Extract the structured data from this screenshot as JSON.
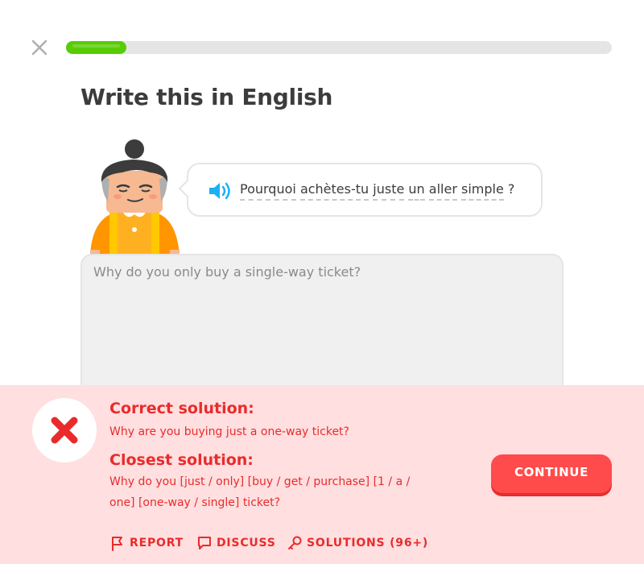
{
  "header": {
    "progress_fraction": 0.11
  },
  "challenge": {
    "title": "Write this in English",
    "prompt_words": [
      "Pourquoi",
      "achètes-tu",
      "juste",
      "un",
      "aller",
      "simple"
    ],
    "prompt_punct": "?",
    "answer_value": "Why do you only buy a single-way ticket?"
  },
  "feedback": {
    "correct_heading": "Correct solution:",
    "correct_text": "Why are you buying just a one-way ticket?",
    "closest_heading": "Closest solution:",
    "closest_line1": "Why do you [just / only] [buy / get / purchase] [1 / a /",
    "closest_line2": "one] [one-way / single] ticket?",
    "continue_label": "CONTINUE",
    "report_label": "REPORT",
    "discuss_label": "DISCUSS",
    "solutions_label": "SOLUTIONS (96+)"
  },
  "colors": {
    "error_red": "#ea2b2b",
    "feedback_bg": "#ffdfe0",
    "progress_green": "#58cc02",
    "speaker_blue": "#1cb0f6"
  },
  "icons": [
    "close-icon",
    "speaker-icon",
    "x-mark-icon",
    "flag-icon",
    "chat-bubble-icon",
    "key-icon"
  ]
}
